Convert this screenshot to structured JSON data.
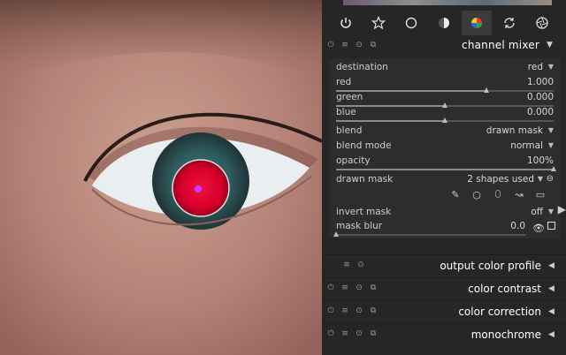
{
  "tabs": [
    {
      "icon": "power-icon"
    },
    {
      "icon": "star-icon"
    },
    {
      "icon": "circle-icon"
    },
    {
      "icon": "tone-icon"
    },
    {
      "icon": "color-wheel-icon"
    },
    {
      "icon": "refresh-icon"
    },
    {
      "icon": "aperture-icon"
    }
  ],
  "module": {
    "title": "channel mixer",
    "rows": {
      "destination": {
        "label": "destination",
        "value": "red"
      },
      "red": {
        "label": "red",
        "value": "1.000",
        "level": 0.69
      },
      "green": {
        "label": "green",
        "value": "0.000",
        "level": 0.5
      },
      "blue": {
        "label": "blue",
        "value": "0.000",
        "level": 0.5
      },
      "blend": {
        "label": "blend",
        "value": "drawn mask"
      },
      "blend_mode": {
        "label": "blend mode",
        "value": "normal"
      },
      "opacity": {
        "label": "opacity",
        "value": "100%",
        "level": 1.0
      },
      "drawn_mask": {
        "label": "drawn mask",
        "value": "2 shapes used"
      },
      "invert_mask": {
        "label": "invert mask",
        "value": "off"
      },
      "mask_blur": {
        "label": "mask blur",
        "value": "0.0",
        "level": 0.0
      }
    }
  },
  "lower_modules": [
    {
      "title": "output color profile"
    },
    {
      "title": "color contrast"
    },
    {
      "title": "color correction"
    },
    {
      "title": "monochrome"
    }
  ]
}
